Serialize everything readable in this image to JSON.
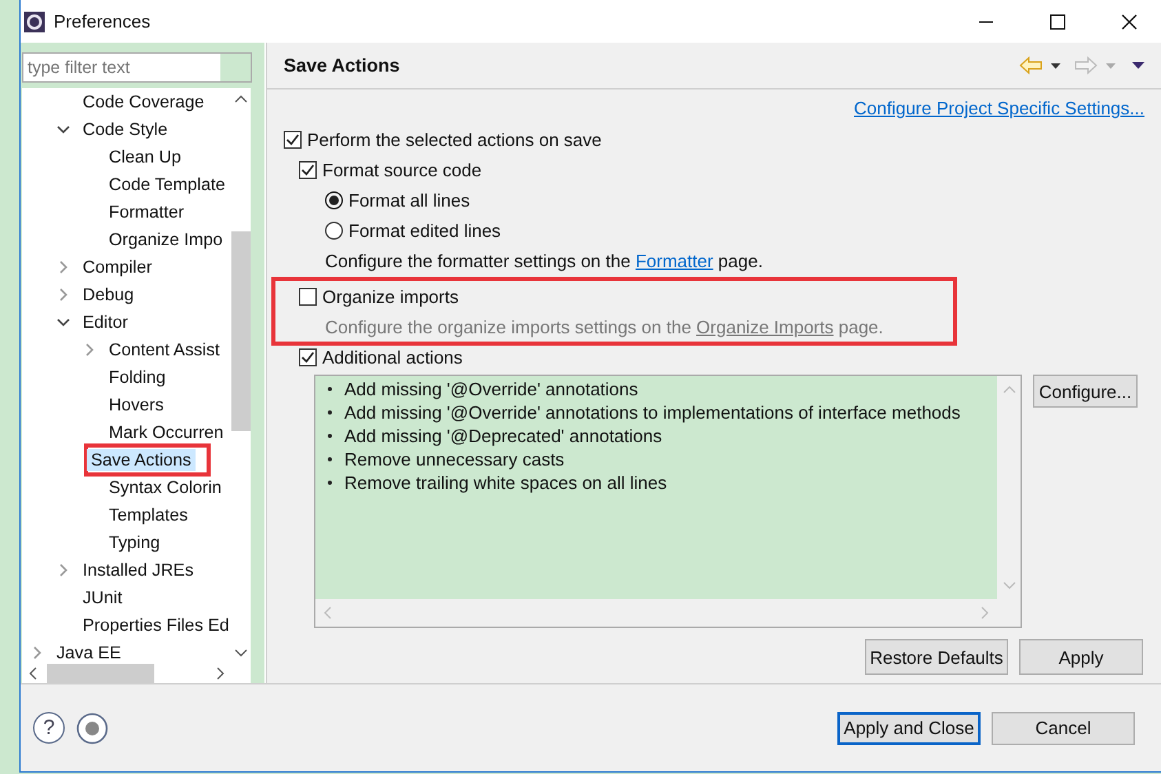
{
  "window": {
    "title": "Preferences"
  },
  "filter": {
    "placeholder": "type filter text"
  },
  "tree": [
    {
      "children": [
        {
          "label": "Code Coverage"
        },
        {
          "label": "Code Style",
          "expanded": true,
          "children": [
            {
              "label": "Clean Up"
            },
            {
              "label": "Code Template"
            },
            {
              "label": "Formatter"
            },
            {
              "label": "Organize Impo"
            }
          ]
        },
        {
          "label": "Compiler",
          "expanded": false
        },
        {
          "label": "Debug",
          "expanded": false
        },
        {
          "label": "Editor",
          "expanded": true,
          "children": [
            {
              "label": "Content Assist",
              "expanded": false
            },
            {
              "label": "Folding"
            },
            {
              "label": "Hovers"
            },
            {
              "label": "Mark Occurren"
            },
            {
              "label": "Save Actions",
              "selected": true,
              "highlighted": true
            },
            {
              "label": "Syntax Colorin"
            },
            {
              "label": "Templates"
            },
            {
              "label": "Typing"
            }
          ]
        },
        {
          "label": "Installed JREs",
          "expanded": false
        },
        {
          "label": "JUnit"
        },
        {
          "label": "Properties Files Ed"
        }
      ]
    },
    {
      "label": "Java EE",
      "expanded": false
    }
  ],
  "page": {
    "title": "Save Actions",
    "project_link": "Configure Project Specific Settings...",
    "options": [
      {
        "kind": "checkbox",
        "label": "Perform the selected actions on save",
        "checked": true,
        "children": [
          {
            "kind": "checkbox",
            "label": "Format source code",
            "checked": true,
            "children": [
              {
                "kind": "radio",
                "label": "Format all lines",
                "selected": true
              },
              {
                "kind": "radio",
                "label": "Format edited lines",
                "selected": false
              },
              {
                "kind": "note",
                "before": "Configure the formatter settings on the ",
                "link": "Formatter",
                "after": " page.",
                "disabled": false
              }
            ]
          },
          {
            "kind": "checkbox",
            "label": "Organize imports",
            "checked": false,
            "highlighted": true,
            "children": [
              {
                "kind": "note",
                "before": "Configure the organize imports settings on the ",
                "link": "Organize Imports",
                "after": " page.",
                "disabled": true
              }
            ]
          },
          {
            "kind": "checkbox",
            "label": "Additional actions",
            "checked": true
          }
        ]
      }
    ],
    "actions": [
      "Add missing '@Override' annotations",
      "Add missing '@Override' annotations to implementations of interface methods",
      "Add missing '@Deprecated' annotations",
      "Remove unnecessary casts",
      "Remove trailing white spaces on all lines"
    ],
    "configure_button": "Configure...",
    "buttons": [
      "Restore Defaults",
      "Apply"
    ]
  },
  "footer": {
    "help": "?",
    "buttons": [
      {
        "label": "Apply and Close",
        "default": true
      },
      {
        "label": "Cancel",
        "default": false
      }
    ]
  }
}
